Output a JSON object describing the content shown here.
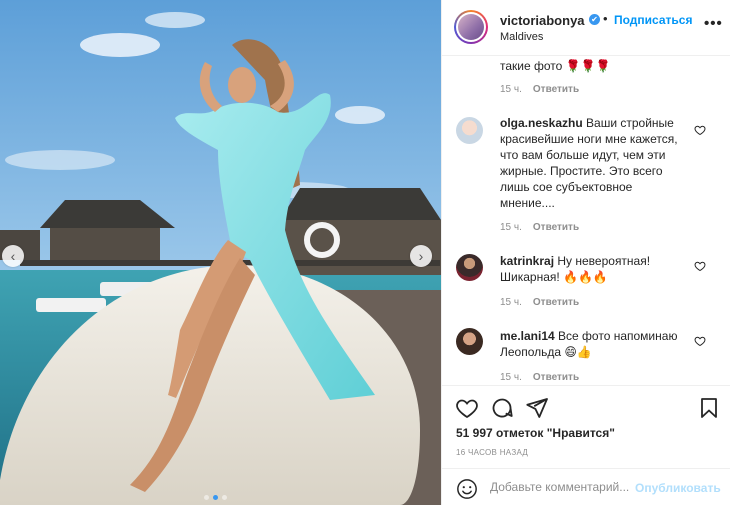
{
  "post": {
    "username": "victoriabonya",
    "verified_mark": "✔",
    "separator": "•",
    "follow_label": "Подписаться",
    "location": "Maldives",
    "more_label": "•••"
  },
  "photo": {
    "prev_arrow": "‹",
    "next_arrow": "›"
  },
  "comments": [
    {
      "username": "",
      "text": "такие фото 🌹🌹🌹",
      "time": "15 ч.",
      "reply": "Ответить"
    },
    {
      "username": "olga.neskazhu",
      "text": "Ваши стройные красивейшие ноги мне кажется, что вам больше идут, чем эти жирные. Простите. Это всего лишь сое субъектовное мнение....",
      "time": "15 ч.",
      "reply": "Ответить"
    },
    {
      "username": "katrinkraj",
      "text": "Ну невероятная! Шикарная! 🔥🔥🔥",
      "time": "15 ч.",
      "reply": "Ответить"
    },
    {
      "username": "me.lani14",
      "text": "Все фото напоминаю Леопольда 😄👍",
      "time": "15 ч.",
      "reply": "Ответить"
    }
  ],
  "actions": {
    "likes": "51 997 отметок \"Нравится\"",
    "time_ago": "16 ЧАСОВ НАЗАД",
    "comment_placeholder": "Добавьте комментарий...",
    "publish_label": "Опубликовать"
  },
  "icons": {
    "like": "heart-icon",
    "comment": "comment-icon",
    "share": "share-icon",
    "save": "bookmark-icon",
    "emoji": "smile-icon"
  },
  "colors": {
    "accent": "#0095f6",
    "publish_disabled": "#b2dffc",
    "muted": "#8e8e8e",
    "text": "#262626"
  },
  "carousel": {
    "slide_count": 3,
    "active_index": 1
  }
}
